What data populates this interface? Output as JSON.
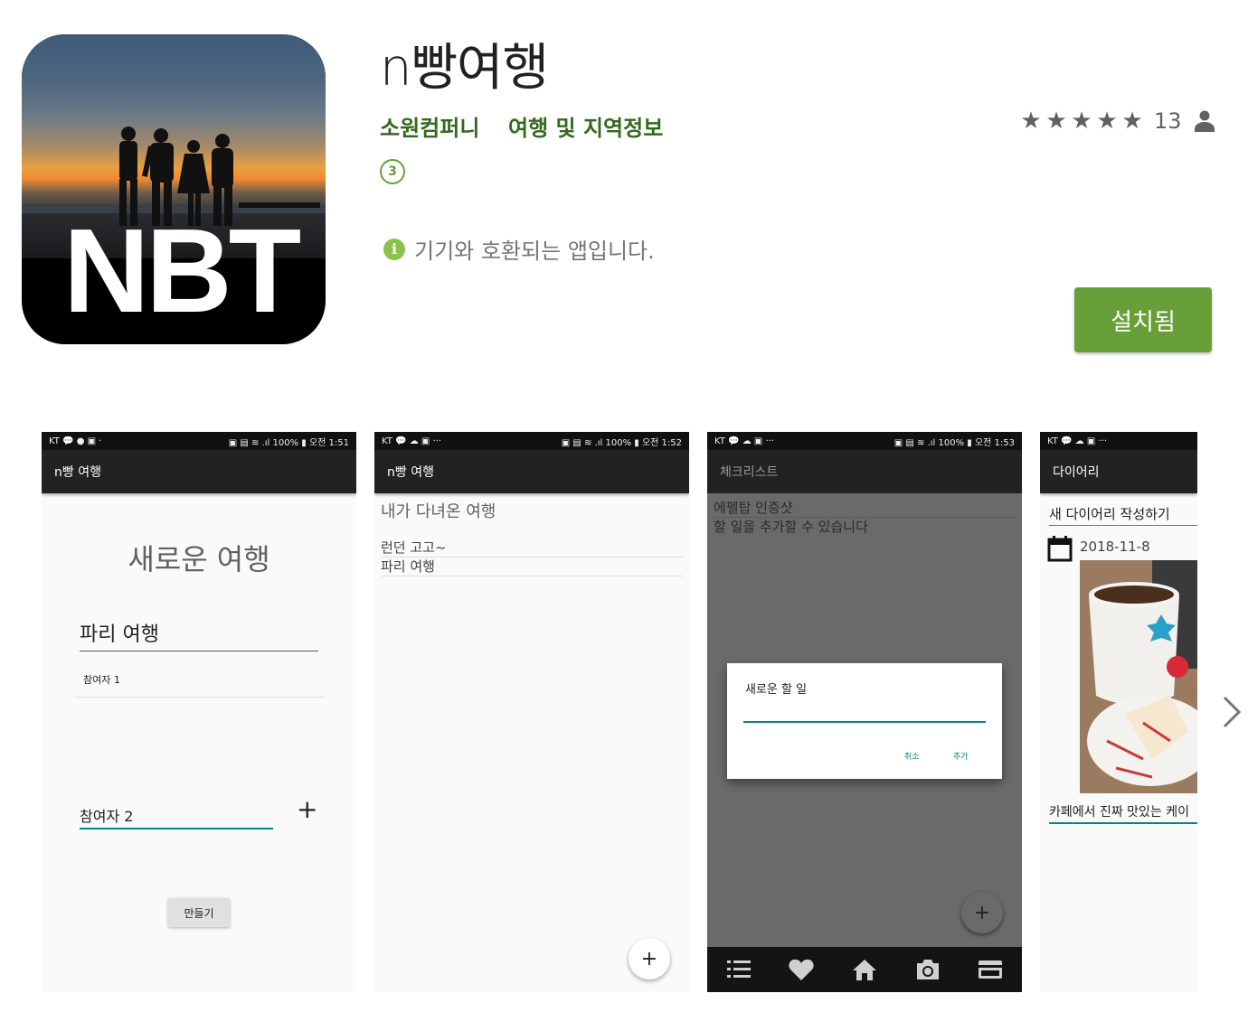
{
  "app": {
    "title": "n빵여행",
    "developer": "소원컴퍼니",
    "category": "여행 및 지역정보",
    "age_rating": "3",
    "rating_count": "13",
    "stars": 5,
    "icon_logo": "NBT",
    "compat_text": "기기와 호환되는 앱입니다.",
    "install_label": "설치됨",
    "accent_color": "#689f38"
  },
  "screenshots": {
    "s1": {
      "status_left": "KT 💬 ● ▣ ·",
      "status_right": "▣ ▤ ≋ .ıl 100% ▮ 오전 1:51",
      "app_bar": "n빵 여행",
      "heading": "새로운 여행",
      "trip_name": "파리 여행",
      "participant1": "참여자 1",
      "participant2": "참여자 2",
      "add_symbol": "+",
      "make_button": "만들기"
    },
    "s2": {
      "status_left": "KT 💬 ☁ ▣ ···",
      "status_right": "▣ ▤ ≋ .ıl 100% ▮ 오전 1:52",
      "app_bar": "n빵 여행",
      "heading": "내가 다녀온 여행",
      "items": [
        "런던 고고~",
        "파리 여행"
      ],
      "fab": "+"
    },
    "s3": {
      "status_left": "KT 💬 ☁ ▣ ···",
      "status_right": "▣ ▤ ≋ .ıl 100% ▮ 오전 1:53",
      "app_bar": "체크리스트",
      "items": [
        "에펠탑 인증샷",
        "할 일을 추가할 수 있습니다"
      ],
      "dialog_title": "새로운 할 일",
      "cancel": "취소",
      "add": "추가",
      "fab": "+",
      "nav_icons": [
        "list-icon",
        "heart-icon",
        "home-icon",
        "camera-icon",
        "card-icon"
      ]
    },
    "s4": {
      "status_left": "KT 💬 ☁ ▣ ···",
      "app_bar": "다이어리",
      "title": "새 다이어리 작성하기",
      "date": "2018-11-8",
      "description": "카페에서 진짜 맛있는 케이"
    }
  }
}
